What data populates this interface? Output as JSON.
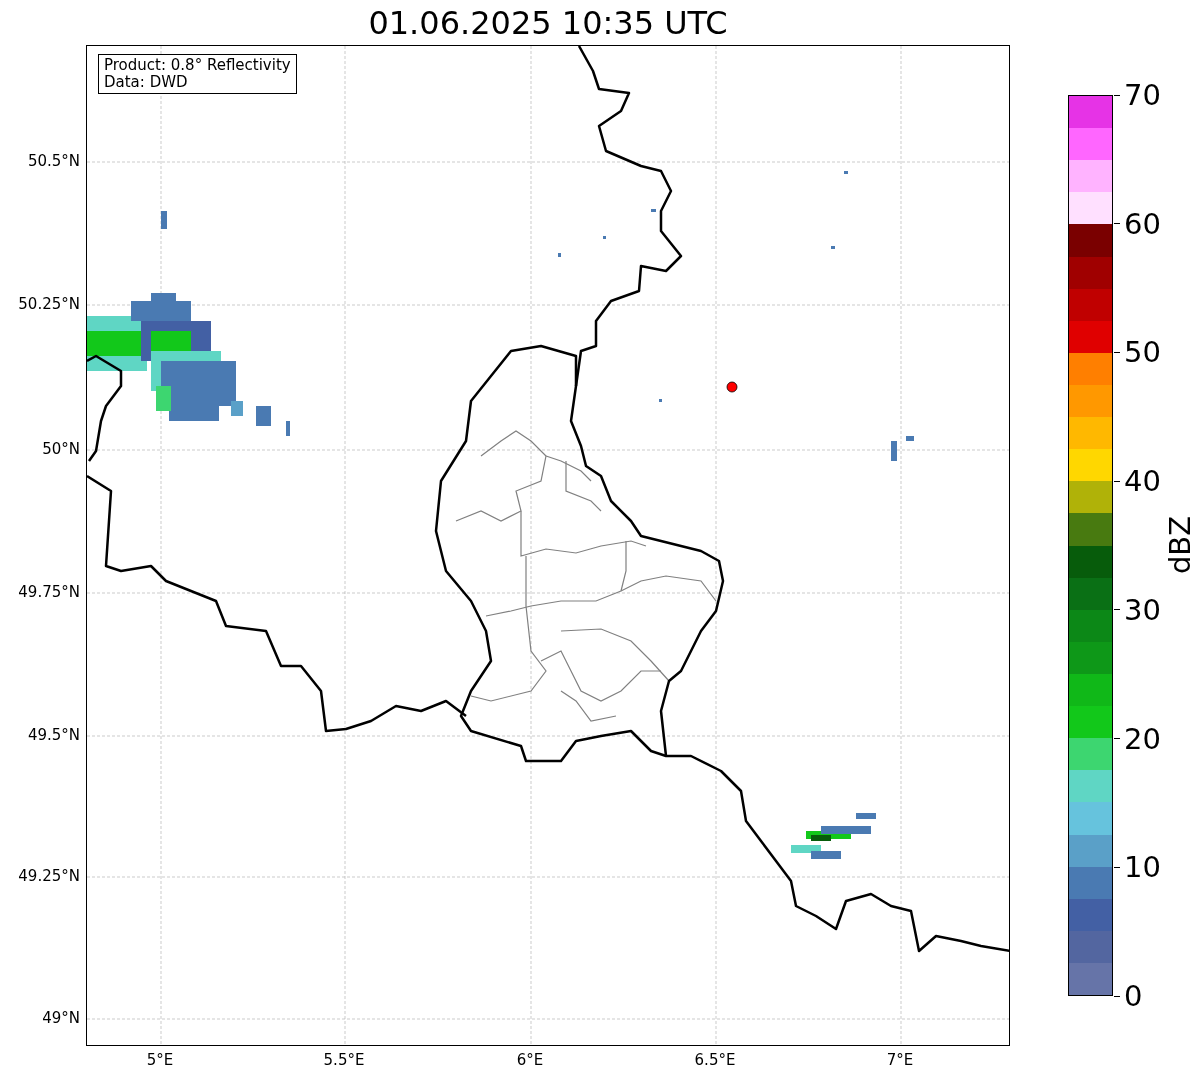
{
  "title": "01.06.2025 10:35 UTC",
  "info_box": [
    "Product: 0.8° Reflectivity",
    "Data: DWD"
  ],
  "map": {
    "lat_ticks": [
      "50.5°N",
      "50.25°N",
      "50°N",
      "49.75°N",
      "49.5°N",
      "49.25°N",
      "49°N"
    ],
    "lon_ticks": [
      "5°E",
      "5.5°E",
      "6°E",
      "6.5°E",
      "7°E"
    ]
  },
  "colorbar": {
    "label": "dBZ",
    "ticks": [
      "70",
      "60",
      "50",
      "40",
      "30",
      "20",
      "10",
      "0"
    ],
    "bands": [
      {
        "color": "#e633e6"
      },
      {
        "color": "#ff66ff"
      },
      {
        "color": "#ffb3ff"
      },
      {
        "color": "#ffe0ff"
      },
      {
        "color": "#7a0000"
      },
      {
        "color": "#a00000"
      },
      {
        "color": "#c00000"
      },
      {
        "color": "#e00000"
      },
      {
        "color": "#ff7f00"
      },
      {
        "color": "#ff9800"
      },
      {
        "color": "#ffb800"
      },
      {
        "color": "#ffd700"
      },
      {
        "color": "#b0b208"
      },
      {
        "color": "#487a10"
      },
      {
        "color": "#075c0b"
      },
      {
        "color": "#0a7015"
      },
      {
        "color": "#0c8817"
      },
      {
        "color": "#0e9818"
      },
      {
        "color": "#10b818"
      },
      {
        "color": "#12c81a"
      },
      {
        "color": "#3dd670"
      },
      {
        "color": "#5fd6c4"
      },
      {
        "color": "#66c3dd"
      },
      {
        "color": "#5aa0c8"
      },
      {
        "color": "#4a7ab2"
      },
      {
        "color": "#4360a4"
      },
      {
        "color": "#5366a0"
      },
      {
        "color": "#6674a8"
      }
    ]
  }
}
